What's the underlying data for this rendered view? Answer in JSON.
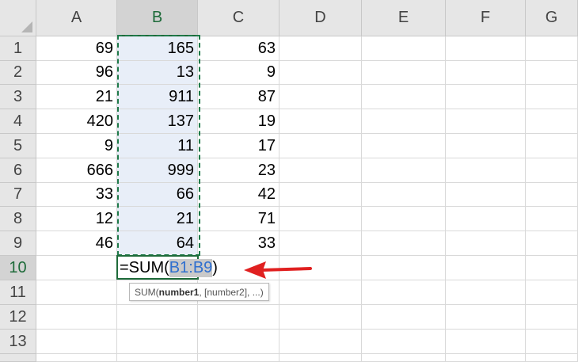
{
  "columns": [
    "A",
    "B",
    "C",
    "D",
    "E",
    "F",
    "G"
  ],
  "rows": [
    "1",
    "2",
    "3",
    "4",
    "5",
    "6",
    "7",
    "8",
    "9",
    "10",
    "11",
    "12",
    "13",
    ""
  ],
  "data": [
    [
      "69",
      "165",
      "63"
    ],
    [
      "96",
      "13",
      "9"
    ],
    [
      "21",
      "911",
      "87"
    ],
    [
      "420",
      "137",
      "19"
    ],
    [
      "9",
      "11",
      "17"
    ],
    [
      "666",
      "999",
      "23"
    ],
    [
      "33",
      "66",
      "42"
    ],
    [
      "12",
      "21",
      "71"
    ],
    [
      "46",
      "64",
      "33"
    ]
  ],
  "formula": {
    "prefix": "=SUM(",
    "ref": "B1:B9",
    "suffix": ")"
  },
  "tooltip": {
    "fn": "SUM(",
    "arg_bold": "number1",
    "rest": ", [number2], ...)"
  },
  "colors": {
    "selection_green": "#1e6b3a",
    "arrow": "#e02020",
    "ref_blue": "#2f6fcf"
  },
  "icons": {
    "arrow": "arrow-left-icon"
  }
}
